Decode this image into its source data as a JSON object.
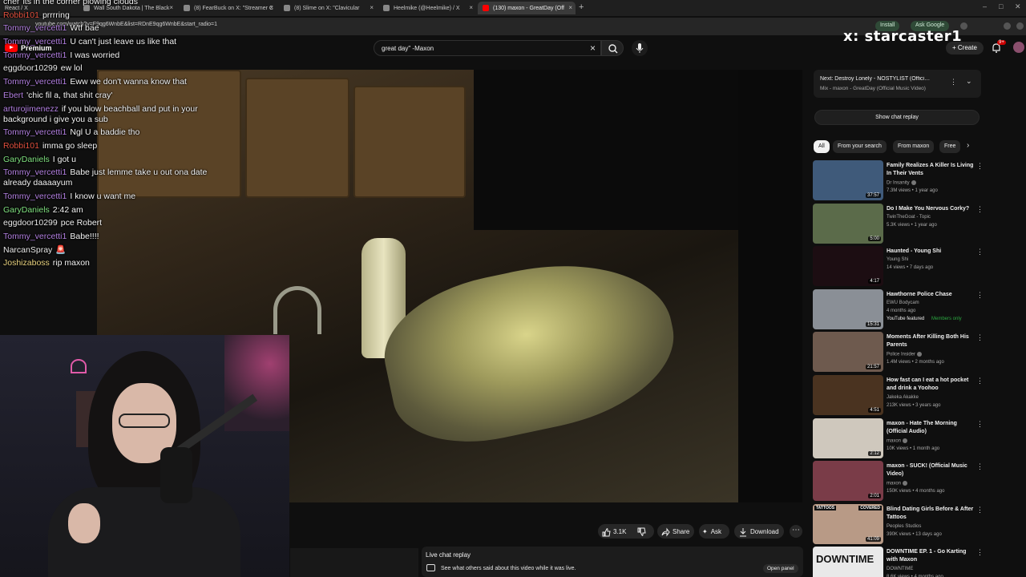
{
  "browser": {
    "tabs": [
      {
        "label": "Wall South Dakota | The Black",
        "active": false
      },
      {
        "label": "(8) FearBuck on X: \"Streamer C",
        "active": false
      },
      {
        "label": "(8) Slime on X: \"Clavicular",
        "active": false
      },
      {
        "label": "Heelmike (@Heelmike) / X",
        "active": false
      },
      {
        "label": "(130) maxon - GreatDay (Off",
        "active": true
      }
    ],
    "first_tab_label": "React / X",
    "url": "youtube.com/watch?v=F9qg6WnbE&list=RDnE9qg6WnbE&start_radio=1",
    "install_label": "Install",
    "ask_google_label": "Ask Google"
  },
  "youtube": {
    "brand": "Premium",
    "search_query": "great day\" -Maxon",
    "create_label": "Create",
    "notification_count": "9+"
  },
  "overlay_name": "x: starcaster1",
  "actions": {
    "likes": "3.1K",
    "share": "Share",
    "ask": "Ask",
    "download": "Download"
  },
  "live_chat": {
    "title": "Live chat replay",
    "description": "See what others said about this video while it was live.",
    "open_label": "Open panel"
  },
  "sidebar": {
    "up_next_title": "Next: Destroy Lonely - NOSTYLIST (Official Vi...",
    "up_next_sub": "Mix - maxon - GreatDay (Official Music Video)",
    "show_chat_label": "Show chat replay",
    "chips": [
      "All",
      "From your search",
      "From maxon",
      "Free"
    ],
    "recommendations": [
      {
        "title": "Family Realizes A Killer Is Living In Their Vents",
        "channel": "Dr Insanity",
        "meta": "7.3M views • 1 year ago",
        "duration": "37:57",
        "verified": true,
        "thumb": "#3f5a7a"
      },
      {
        "title": "Do I Make You Nervous Corky?",
        "channel": "TwinTheGoat - Topic",
        "meta": "5.3K views • 1 year ago",
        "duration": "5:00",
        "verified": false,
        "thumb": "#5b6b4a"
      },
      {
        "title": "Haunted - Young Shi",
        "channel": "Young Shi",
        "meta": "14 views • 7 days ago",
        "duration": "4:17",
        "verified": false,
        "thumb": "#1c0d12"
      },
      {
        "title": "Hawthorne Police Chase",
        "channel": "EWU Bodycam",
        "meta": "4 months ago",
        "duration": "15:31",
        "verified": false,
        "thumb": "#8a8f96",
        "featured": "YouTube featured",
        "members": "Members only"
      },
      {
        "title": "Moments After Killing Both His Parents",
        "channel": "Police Insider",
        "meta": "1.4M views • 2 months ago",
        "duration": "21:57",
        "verified": true,
        "thumb": "#6e5a4e"
      },
      {
        "title": "How fast can I eat a hot pocket and drink a Yoohoo",
        "channel": "Jakeka Akakke",
        "meta": "213K views • 3 years ago",
        "duration": "4:51",
        "verified": false,
        "thumb": "#4a3320"
      },
      {
        "title": "maxon - Hate The Morning (Official Audio)",
        "channel": "maxon",
        "meta": "10K views • 1 month ago",
        "duration": "2:12",
        "verified": true,
        "thumb": "#cfc8bd"
      },
      {
        "title": "maxon - SUCK! (Official Music Video)",
        "channel": "maxon",
        "meta": "150K views • 4 months ago",
        "duration": "2:01",
        "verified": true,
        "thumb": "#7a3c48"
      },
      {
        "title": "Blind Dating Girls Before & After Tattoos",
        "channel": "Peoples Studios",
        "meta": "390K views • 13 days ago",
        "duration": "41:09",
        "verified": false,
        "thumb": "#b89a86",
        "badge_left": "TATTOOS",
        "badge_right": "COVERED"
      },
      {
        "title": "DOWNTIME EP. 1 - Go Karting with Maxon",
        "channel": "DOWNTIME",
        "meta": "8.6K views • 4 months ago",
        "duration": "",
        "verified": false,
        "thumb": "#e9e9e9",
        "thumb_text": "DOWNTIME"
      }
    ]
  },
  "chat": [
    {
      "user": "cher",
      "color": "#e8e8e8",
      "text": "its in the corner plowing clouds"
    },
    {
      "user": "Robbi101",
      "color": "#e0503e",
      "text": "prrrring"
    },
    {
      "user": "Tommy_vercetti1",
      "color": "#b27fe0",
      "text": "Wtf bae"
    },
    {
      "user": "Tommy_vercetti1",
      "color": "#b27fe0",
      "text": "U can't just leave us like that"
    },
    {
      "user": "Tommy_vercetti1",
      "color": "#b27fe0",
      "text": "I was worried"
    },
    {
      "user": "eggdoor10299",
      "color": "#e8e8e8",
      "text": "ew lol"
    },
    {
      "user": "Tommy_vercetti1",
      "color": "#b27fe0",
      "text": "Eww we don't wanna know that"
    },
    {
      "user": "Ebert",
      "color": "#b27fe0",
      "text": "'chic fil a, that shit cray'"
    },
    {
      "user": "arturojimenezz",
      "color": "#b27fe0",
      "text": "if you blow beachball and put in your background i give you a sub"
    },
    {
      "user": "Tommy_vercetti1",
      "color": "#b27fe0",
      "text": "Ngl U a baddie tho"
    },
    {
      "user": "Robbi101",
      "color": "#e0503e",
      "text": "imma go sleep"
    },
    {
      "user": "GaryDaniels",
      "color": "#7fe07f",
      "text": "I got u"
    },
    {
      "user": "Tommy_vercetti1",
      "color": "#b27fe0",
      "text": "Babe just lemme take u out ona date already daaaayum"
    },
    {
      "user": "Tommy_vercetti1",
      "color": "#b27fe0",
      "text": "I know u want me"
    },
    {
      "user": "GaryDaniels",
      "color": "#7fe07f",
      "text": "2:42 am"
    },
    {
      "user": "eggdoor10299",
      "color": "#e8e8e8",
      "text": "pce Robert"
    },
    {
      "user": "Tommy_vercetti1",
      "color": "#b27fe0",
      "text": "Babe!!!!"
    },
    {
      "user": "NarcanSpray",
      "color": "#e8e8e8",
      "text": "🚨"
    },
    {
      "user": "Joshizaboss",
      "color": "#e8d27f",
      "text": "rip maxon"
    }
  ]
}
